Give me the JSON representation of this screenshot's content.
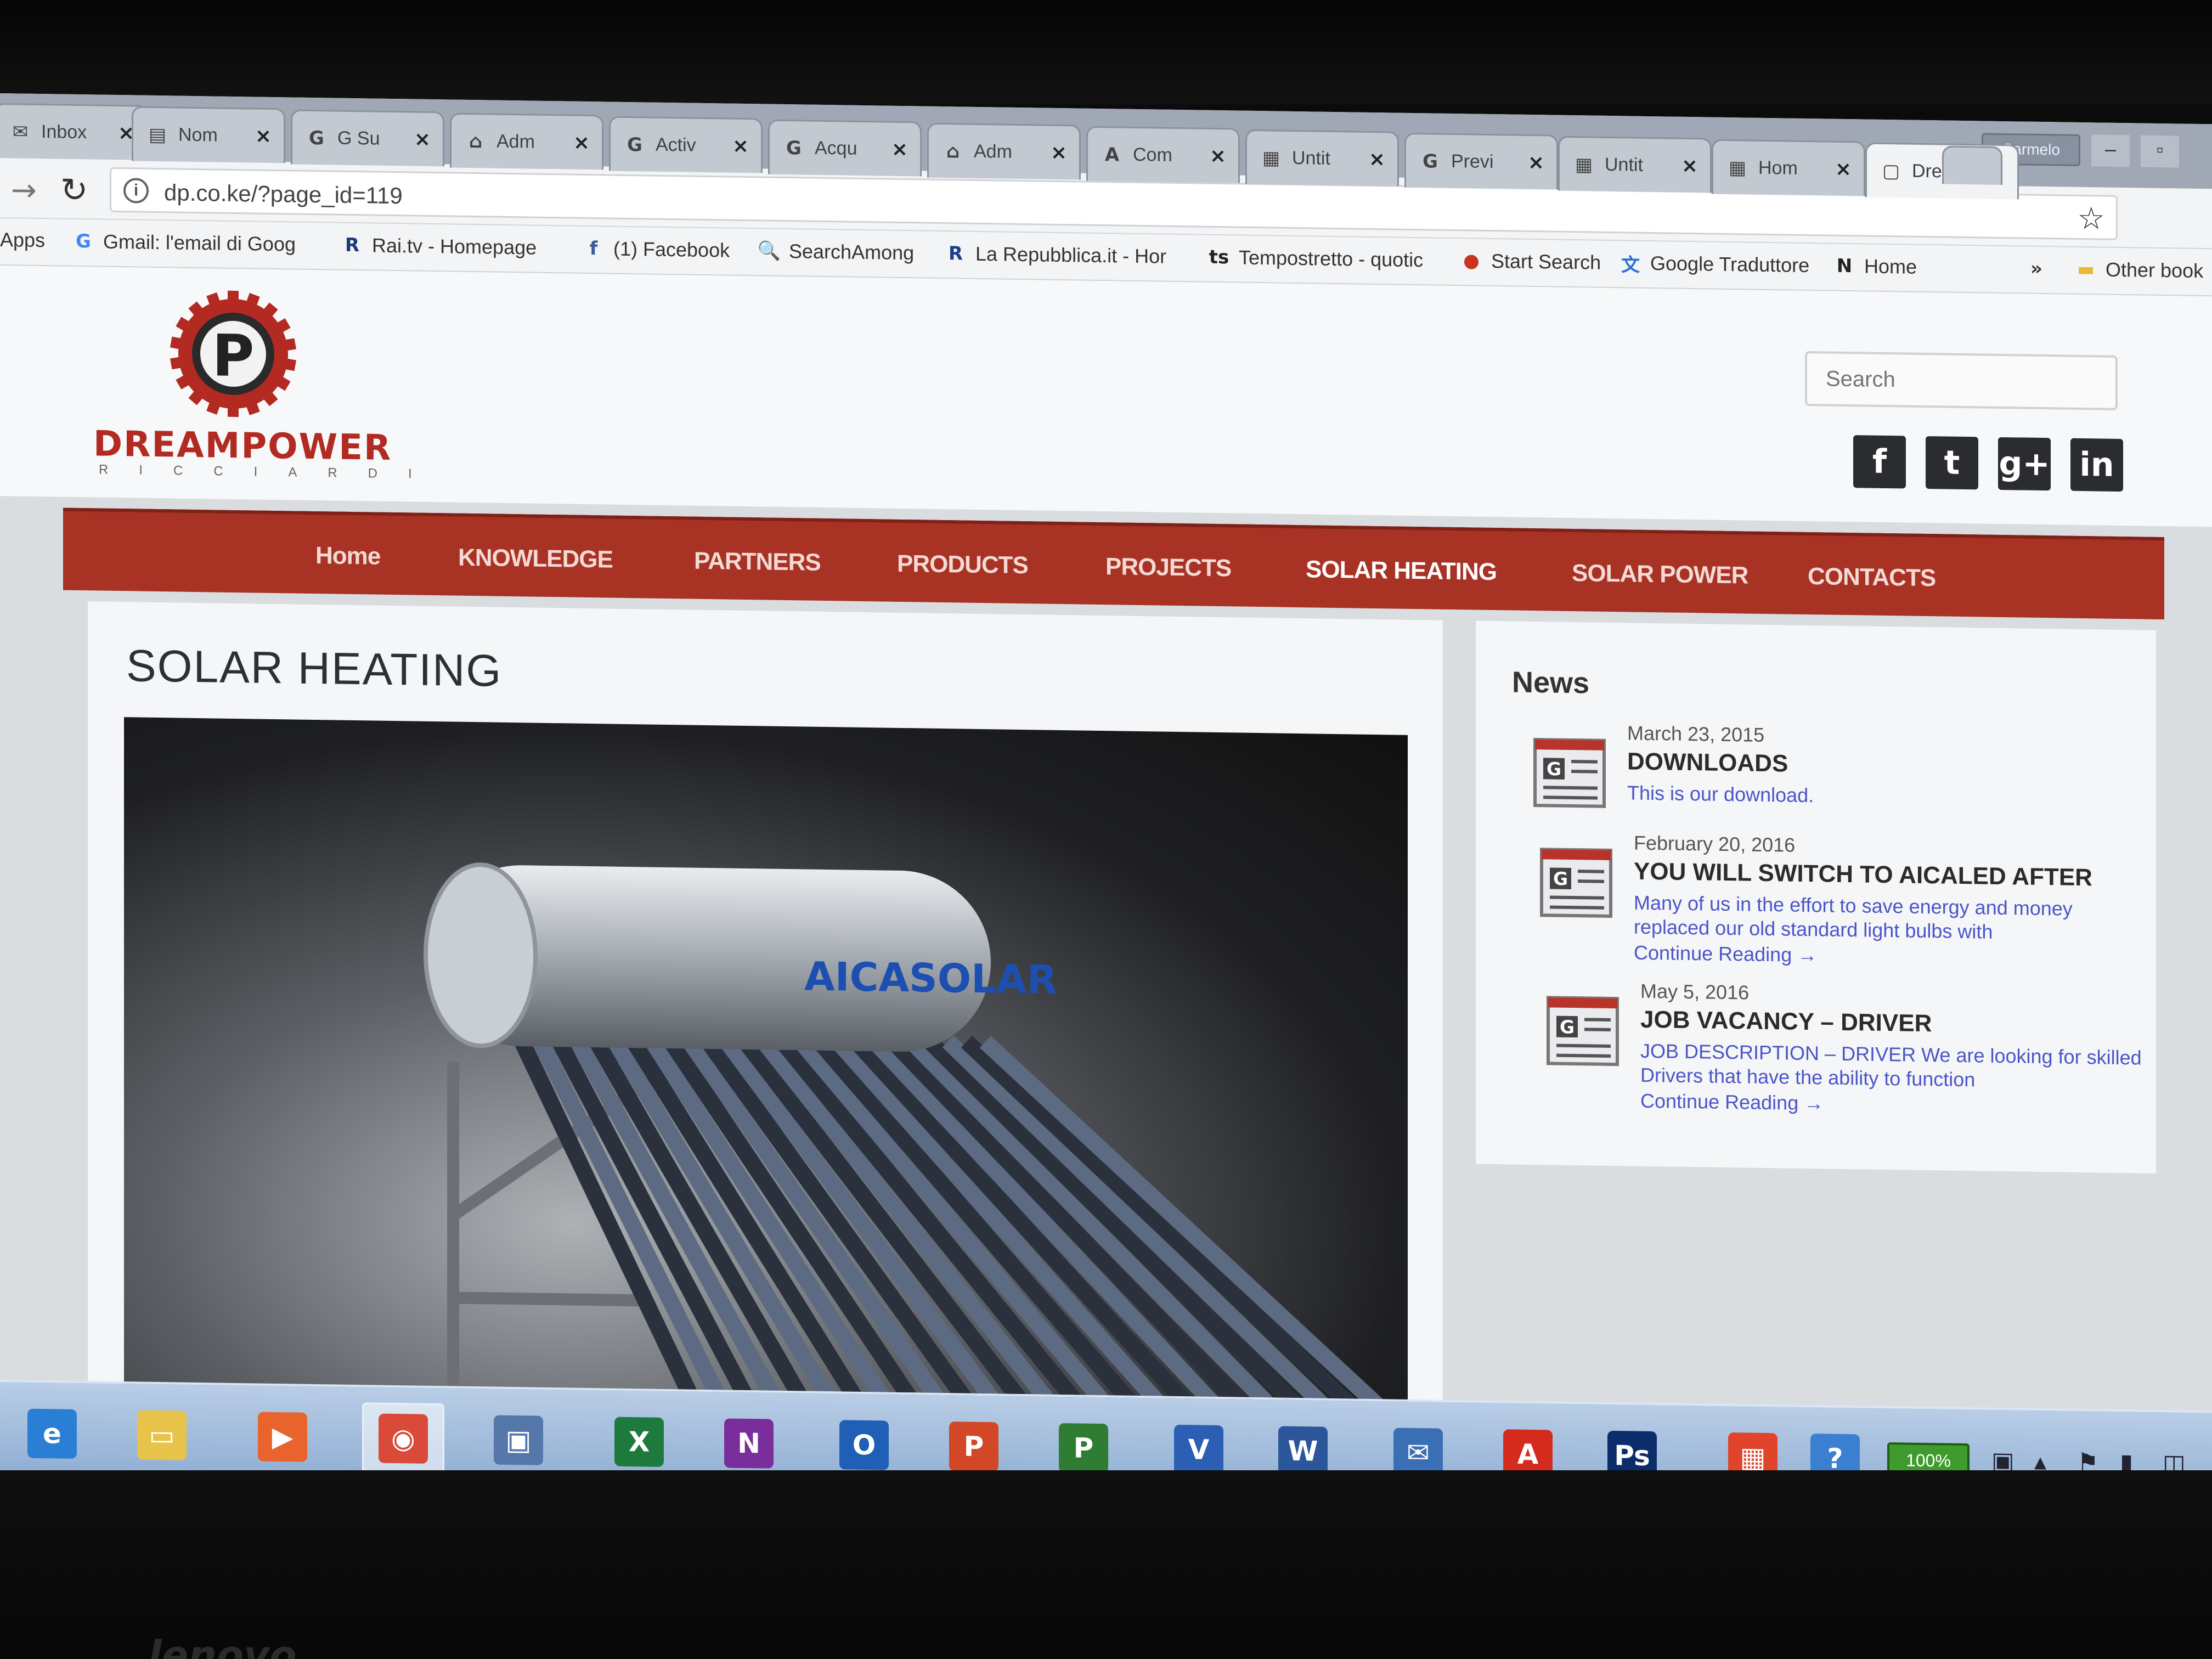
{
  "browser": {
    "tabs": [
      {
        "icon": "mail-icon",
        "glyph": "✉",
        "label": "Inbox"
      },
      {
        "icon": "doc-icon",
        "glyph": "▤",
        "label": "Nom"
      },
      {
        "icon": "google-icon",
        "glyph": "G",
        "label": "G Su"
      },
      {
        "icon": "wordpress-icon",
        "glyph": "⌂",
        "label": "Adm"
      },
      {
        "icon": "google-icon",
        "glyph": "G",
        "label": "Activ"
      },
      {
        "icon": "google-icon",
        "glyph": "G",
        "label": "Acqu"
      },
      {
        "icon": "wordpress-icon",
        "glyph": "⌂",
        "label": "Adm"
      },
      {
        "icon": "acrobat-icon",
        "glyph": "A",
        "label": "Com"
      },
      {
        "icon": "page-icon",
        "glyph": "▦",
        "label": "Untit"
      },
      {
        "icon": "google-icon",
        "glyph": "G",
        "label": "Previ"
      },
      {
        "icon": "page-icon",
        "glyph": "▦",
        "label": "Untit"
      },
      {
        "icon": "page-icon",
        "glyph": "▦",
        "label": "Hom"
      },
      {
        "icon": "doc-icon",
        "glyph": "▢",
        "label": "Drea"
      }
    ],
    "user_button": "Carmelo",
    "url": "dp.co.ke/?page_id=119",
    "bookmarks": [
      {
        "icon": "apps-icon",
        "glyph": "",
        "label": "Apps"
      },
      {
        "icon": "google-icon",
        "glyph": "G",
        "label": "Gmail: l'email di Goog"
      },
      {
        "icon": "rai-icon",
        "glyph": "R",
        "label": "Rai.tv - Homepage"
      },
      {
        "icon": "facebook-icon",
        "glyph": "f",
        "label": "(1) Facebook"
      },
      {
        "icon": "search-icon",
        "glyph": "🔍",
        "label": "SearchAmong"
      },
      {
        "icon": "repubblica-icon",
        "glyph": "R",
        "label": "La Repubblica.it - Hor"
      },
      {
        "icon": "ts-icon",
        "glyph": "ts",
        "label": "Tempostretto - quotic"
      },
      {
        "icon": "start-icon",
        "glyph": "●",
        "label": "Start Search"
      },
      {
        "icon": "translate-icon",
        "glyph": "文",
        "label": "Google Traduttore"
      },
      {
        "icon": "n-icon",
        "glyph": "N",
        "label": "Home"
      },
      {
        "icon": "overflow-icon",
        "glyph": "»",
        "label": ""
      },
      {
        "icon": "folder-icon",
        "glyph": "▬",
        "label": "Other book"
      }
    ]
  },
  "site": {
    "logo_name": "DREAMPOWER",
    "logo_sub": "RICCIARDI",
    "search_placeholder": "Search",
    "social": [
      {
        "icon": "facebook-icon",
        "glyph": "f"
      },
      {
        "icon": "twitter-icon",
        "glyph": "t"
      },
      {
        "icon": "googleplus-icon",
        "glyph": "g+"
      },
      {
        "icon": "linkedin-icon",
        "glyph": "in"
      }
    ],
    "nav": [
      "Home",
      "KNOWLEDGE",
      "PARTNERS",
      "PRODUCTS",
      "PROJECTS",
      "SOLAR HEATING",
      "SOLAR POWER",
      "CONTACTS"
    ],
    "nav_current": "SOLAR HEATING",
    "page_title": "SOLAR HEATING",
    "hero_brand": "AICASOLAR",
    "news": {
      "title": "News",
      "items": [
        {
          "date": "March 23, 2015",
          "headline": "DOWNLOADS",
          "text": "This is our download.",
          "more": ""
        },
        {
          "date": "February 20, 2016",
          "headline": "YOU WILL SWITCH TO AICALED AFTER",
          "text": "Many of us in the effort to save energy and money replaced our old standard light bulbs with",
          "more": "Continue Reading →"
        },
        {
          "date": "May 5, 2016",
          "headline": "JOB VACANCY – DRIVER",
          "text": "JOB DESCRIPTION – DRIVER  We are looking for skilled Drivers that have the ability to function",
          "more": "Continue Reading →"
        }
      ]
    }
  },
  "taskbar": {
    "apps": [
      {
        "icon": "internet-explorer-icon",
        "glyph": "e",
        "color": "#2a7fd4"
      },
      {
        "icon": "file-explorer-icon",
        "glyph": "▭",
        "color": "#e8c34a"
      },
      {
        "icon": "media-player-icon",
        "glyph": "▶",
        "color": "#e8642c"
      },
      {
        "icon": "chrome-icon",
        "glyph": "◉",
        "color": "#d94a38"
      },
      {
        "icon": "calendar-icon",
        "glyph": "▣",
        "color": "#5577aa"
      },
      {
        "icon": "excel-icon",
        "glyph": "X",
        "color": "#1e7a3c"
      },
      {
        "icon": "onenote-icon",
        "glyph": "N",
        "color": "#7a2e9b"
      },
      {
        "icon": "outlook-icon",
        "glyph": "O",
        "color": "#1f5fb5"
      },
      {
        "icon": "powerpoint-icon",
        "glyph": "P",
        "color": "#d24726"
      },
      {
        "icon": "project-icon",
        "glyph": "P",
        "color": "#2f7d32"
      },
      {
        "icon": "visio-icon",
        "glyph": "V",
        "color": "#2b5fb3"
      },
      {
        "icon": "word-icon",
        "glyph": "W",
        "color": "#2b579a"
      },
      {
        "icon": "thunderbird-icon",
        "glyph": "✉",
        "color": "#3a6fb6"
      },
      {
        "icon": "acrobat-icon",
        "glyph": "A",
        "color": "#d52b1e"
      },
      {
        "icon": "photoshop-icon",
        "glyph": "Ps",
        "color": "#0c2d6b"
      },
      {
        "icon": "office-icon",
        "glyph": "▦",
        "color": "#e0452c"
      },
      {
        "icon": "help-icon",
        "glyph": "?",
        "color": "#3a7fd0"
      }
    ],
    "battery": "100%",
    "tray": [
      "power-icon",
      "arrow-up-icon",
      "flag-icon",
      "network-icon",
      "volume-icon"
    ]
  },
  "laptop_brand": "lenovo"
}
